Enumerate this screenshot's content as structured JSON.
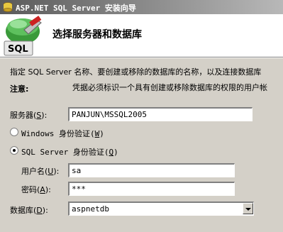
{
  "window": {
    "title": "ASP.NET SQL Server 安装向导"
  },
  "header": {
    "title": "选择服务器和数据库",
    "logo_text": "SQL"
  },
  "description": "指定 SQL Server 名称、要创建或移除的数据库的名称，以及连接数据库",
  "note": {
    "label": "注意:",
    "text": "凭据必须标识一个具有创建或移除数据库的权限的用户帐"
  },
  "server": {
    "label": "服务器(",
    "accel": "S",
    "label_end": "):",
    "value": "PANJUN\\MSSQL2005"
  },
  "auth": {
    "windows": {
      "label": "Windows 身份验证(",
      "accel": "W",
      "label_end": ")",
      "selected": false
    },
    "sql": {
      "label": "SQL Server 身份验证(",
      "accel": "Q",
      "label_end": ")",
      "selected": true
    }
  },
  "username": {
    "label": "用户名(",
    "accel": "U",
    "label_end": "):",
    "value": "sa"
  },
  "password": {
    "label": "密码(",
    "accel": "A",
    "label_end": "):",
    "value": "***"
  },
  "database": {
    "label": "数据库(",
    "accel": "D",
    "label_end": "):",
    "value": "aspnetdb"
  }
}
